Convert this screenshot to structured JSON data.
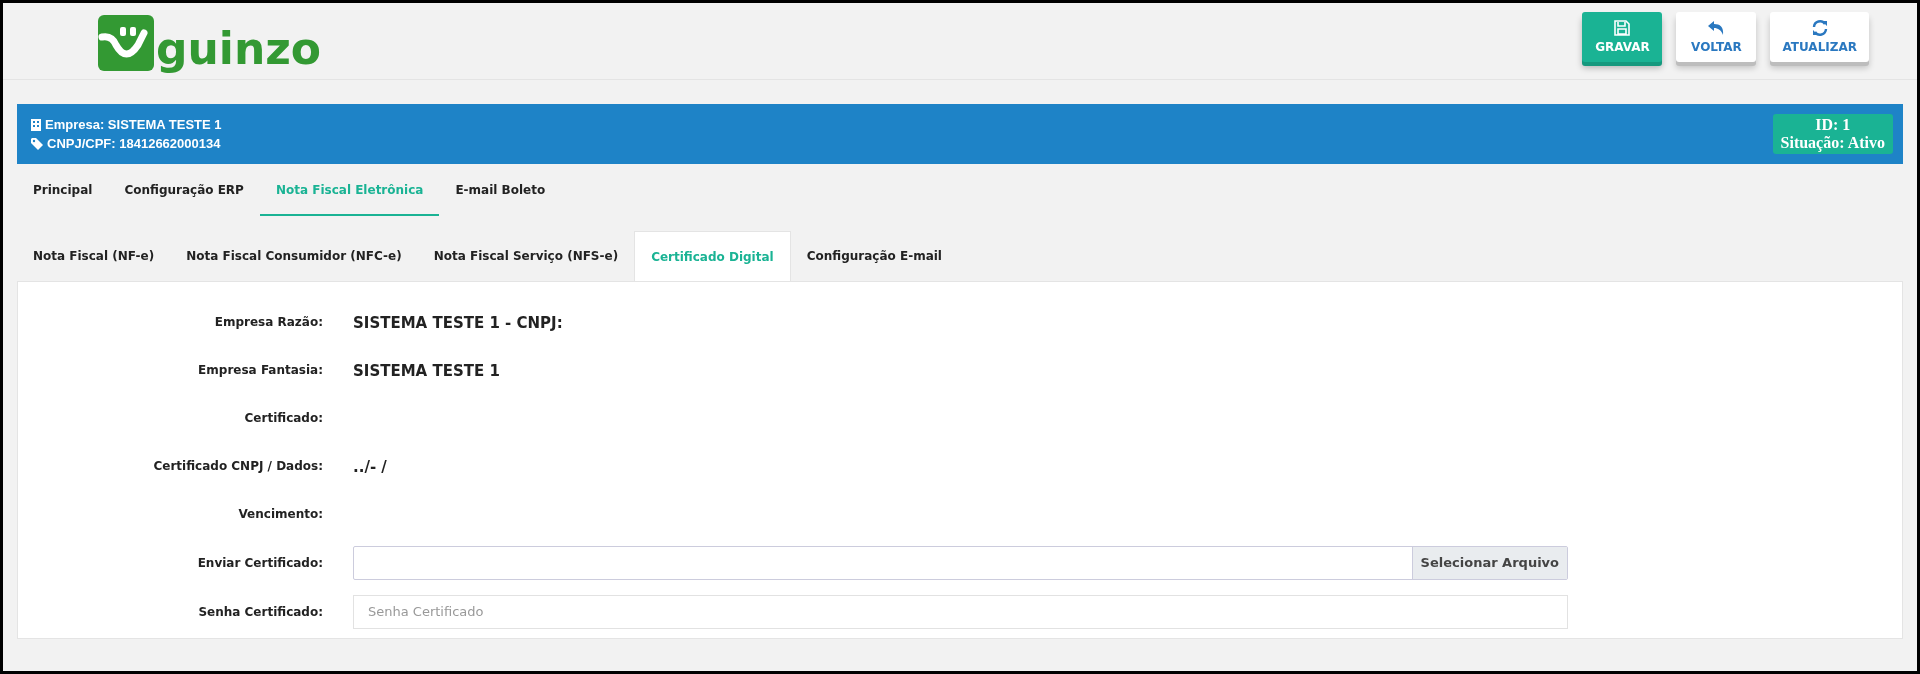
{
  "logo": {
    "text": "guinzo"
  },
  "toolbar": [
    {
      "kind": "save",
      "label": "GRAVAR"
    },
    {
      "kind": "back",
      "label": "VOLTAR"
    },
    {
      "kind": "refresh",
      "label": "ATUALIZAR"
    }
  ],
  "company_bar": {
    "empresa": "Empresa: SISTEMA TESTE 1",
    "cnpj": "CNPJ/CPF: 18412662000134",
    "id": "ID: 1",
    "situacao": "Situação: Ativo"
  },
  "tabs": [
    {
      "label": "Principal",
      "selected": false
    },
    {
      "label": "Configuração ERP",
      "selected": false
    },
    {
      "label": "Nota Fiscal Eletrônica",
      "selected": true
    },
    {
      "label": "E-mail Boleto",
      "selected": false
    }
  ],
  "subtabs": [
    {
      "label": "Nota Fiscal (NF-e)",
      "selected": false
    },
    {
      "label": "Nota Fiscal Consumidor (NFC-e)",
      "selected": false
    },
    {
      "label": "Nota Fiscal Serviço (NFS-e)",
      "selected": false
    },
    {
      "label": "Certificado Digital",
      "selected": true
    },
    {
      "label": "Configuração E-mail",
      "selected": false
    }
  ],
  "form": [
    {
      "kind": "text",
      "label": "Empresa Razão:",
      "value": "SISTEMA TESTE 1 - CNPJ:"
    },
    {
      "kind": "text",
      "label": "Empresa Fantasia:",
      "value": "SISTEMA TESTE 1"
    },
    {
      "kind": "text",
      "label": "Certificado:"
    },
    {
      "kind": "text",
      "label": "Certificado CNPJ / Dados:",
      "value": "../- /"
    },
    {
      "kind": "text",
      "label": "Vencimento:"
    },
    {
      "kind": "file",
      "label": "Enviar Certificado:",
      "button": "Selecionar Arquivo"
    },
    {
      "kind": "password",
      "label": "Senha Certificado:",
      "placeholder": "Senha Certificado"
    }
  ]
}
